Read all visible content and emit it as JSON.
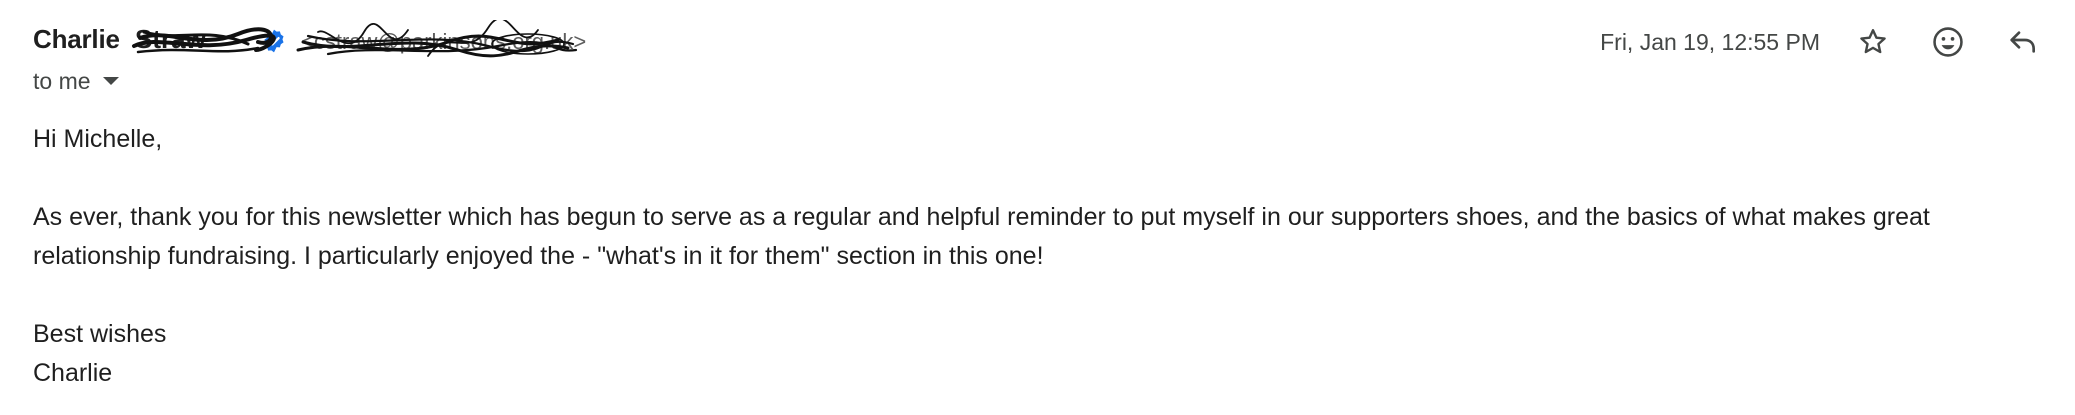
{
  "sender": {
    "name": "Charlie",
    "surname_redacted": "Straw",
    "email_redacted": "<cstraw@parkinsons.org.uk>"
  },
  "date": "Fri, Jan 19, 12:55 PM",
  "recipient": "to me",
  "icons": {
    "verified": "verified-badge-icon",
    "star": "star-icon",
    "emoji": "emoji-icon",
    "reply": "reply-icon",
    "caret": "chevron-down-icon"
  },
  "colors": {
    "verified": "#1a73e8",
    "text": "#1f1f1f",
    "muted": "#444746"
  },
  "body": {
    "greeting": "Hi Michelle,",
    "paragraph_line1": "As ever, thank you for this newsletter which has begun to serve as a regular and helpful reminder to put myself in our supporters shoes, and the basics of what makes great",
    "paragraph_line2": "relationship fundraising. I particularly enjoyed the - \"what's in it for them\" section in this one!",
    "signoff": "Best wishes",
    "signature": "Charlie"
  }
}
